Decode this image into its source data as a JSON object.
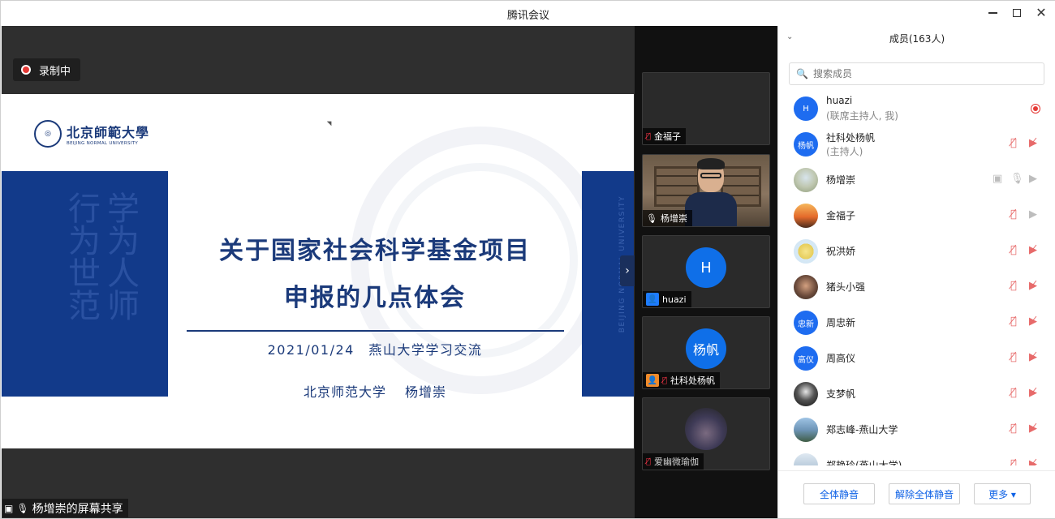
{
  "window": {
    "title": "腾讯会议"
  },
  "share": {
    "recording_label": "录制中",
    "sharer_label": "杨增崇的屏幕共享",
    "slide": {
      "logo_cn": "北京師範大學",
      "logo_en": "BEIJING NORMAL UNIVERSITY",
      "motto": "学为人师 行为世范",
      "vertical_en": "BEIJING NORMAL UNIVERSITY",
      "title_line1": "关于国家社会科学基金项目",
      "title_line2": "申报的几点体会",
      "date_line": "2021/01/24　燕山大学学习交流",
      "author_line": "北京师范大学　 杨增崇"
    }
  },
  "videos": [
    {
      "name": "金福子",
      "mic": "off"
    },
    {
      "name": "杨增崇",
      "mic": "on"
    },
    {
      "name": "huazi",
      "avatar_text": "H",
      "mic": "none"
    },
    {
      "name": "社科处杨帆",
      "avatar_text": "杨帆",
      "mic": "off"
    },
    {
      "name": "爱幽微瑜伽",
      "mic": "off"
    }
  ],
  "members": {
    "header": "成员(163人)",
    "search_placeholder": "搜索成员",
    "list": [
      {
        "name": "huazi",
        "role": "(联席主持人, 我)",
        "avatar_text": "H",
        "status": "recording"
      },
      {
        "name": "社科处杨帆",
        "role": "(主持人)",
        "avatar_text": "杨帆",
        "status": "muted"
      },
      {
        "name": "杨增崇",
        "role": "",
        "avatar_text": "",
        "status": "sharing"
      },
      {
        "name": "金福子",
        "role": "",
        "avatar_text": "",
        "status": "muted"
      },
      {
        "name": "祝洪娇",
        "role": "",
        "avatar_text": "",
        "status": "muted"
      },
      {
        "name": "猪头小强",
        "role": "",
        "avatar_text": "",
        "status": "muted"
      },
      {
        "name": "周忠新",
        "role": "",
        "avatar_text": "忠新",
        "status": "muted"
      },
      {
        "name": "周高仪",
        "role": "",
        "avatar_text": "高仪",
        "status": "muted"
      },
      {
        "name": "支梦帆",
        "role": "",
        "avatar_text": "",
        "status": "muted"
      },
      {
        "name": "郑志峰-燕山大学",
        "role": "",
        "avatar_text": "",
        "status": "muted"
      },
      {
        "name": "郑艳玲(燕山大学)",
        "role": "",
        "avatar_text": "",
        "status": "muted"
      }
    ],
    "footer": {
      "mute_all": "全体静音",
      "unmute_all": "解除全体静音",
      "more": "更多 ▾"
    }
  },
  "colors": {
    "accent": "#0f62e6",
    "slide_blue": "#123a8a",
    "record_red": "#e53935"
  }
}
